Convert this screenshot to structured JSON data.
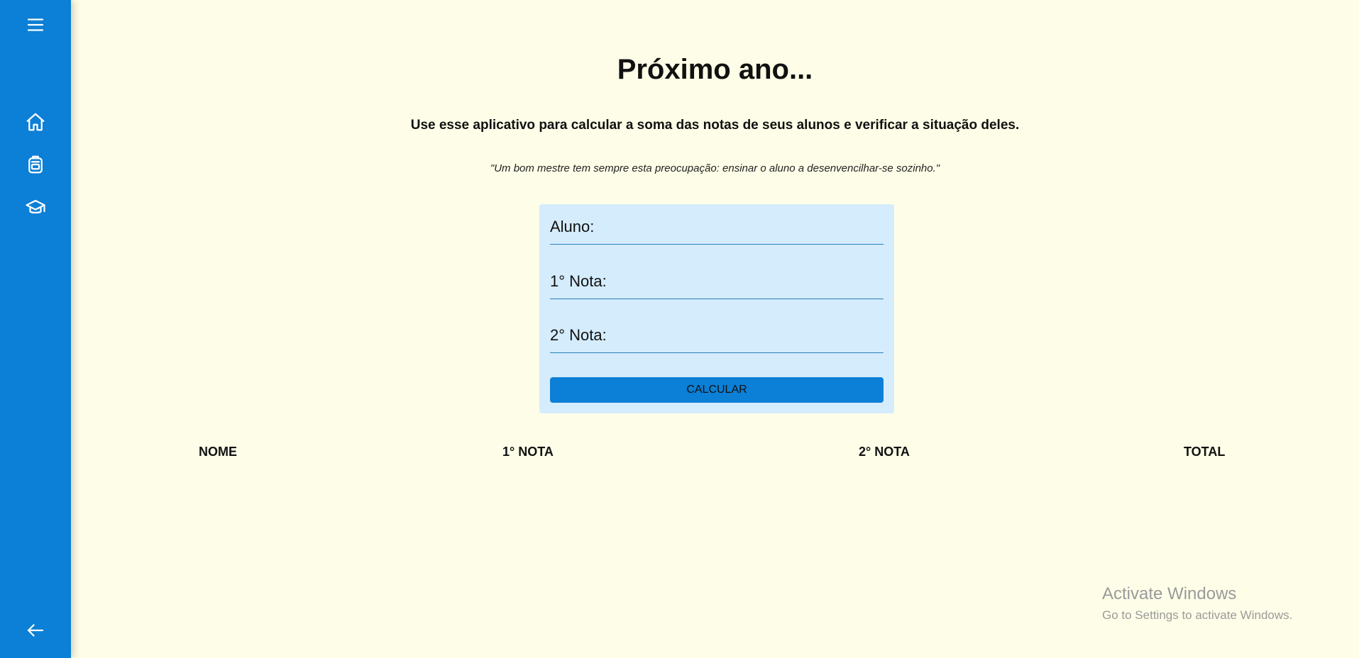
{
  "sidebar": {
    "menu_icon": "menu-icon",
    "items": [
      {
        "icon": "home-icon"
      },
      {
        "icon": "backpack-icon"
      },
      {
        "icon": "graduation-cap-icon"
      }
    ],
    "back_icon": "arrow-left-icon",
    "color": "#0c7fd6"
  },
  "page": {
    "title": "Próximo ano...",
    "subtitle": "Use esse aplicativo para calcular a soma das notas de seus alunos e verificar a situação deles.",
    "quote": "\"Um bom mestre tem sempre esta preocupação: ensinar o aluno a desenvencilhar-se sozinho.\""
  },
  "form": {
    "aluno_label": "Aluno:",
    "nota1_label": "1° Nota:",
    "nota2_label": "2° Nota:",
    "button_label": "CALCULAR"
  },
  "table": {
    "headers": [
      "NOME",
      "1° NOTA",
      "2° NOTA",
      "TOTAL"
    ]
  },
  "watermark": {
    "line1": "Activate Windows",
    "line2": "Go to Settings to activate Windows."
  }
}
